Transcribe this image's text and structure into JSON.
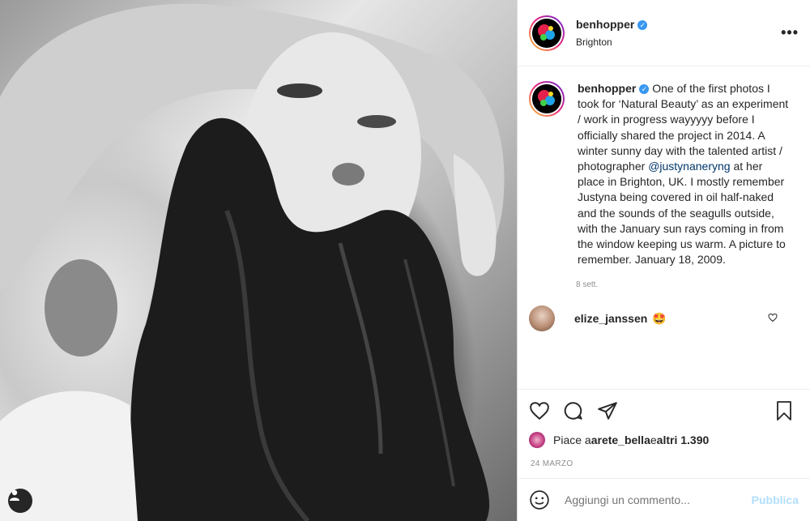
{
  "post": {
    "username": "benhopper",
    "location": "Brighton",
    "more_label": "•••",
    "verified_glyph": "✓",
    "caption_before_mention": "One of the first photos I took for ‘Natural Beauty’ as an experiment / work in progress wayyyyy before I officially shared the project in 2014. A winter sunny day with the talented artist / photographer ",
    "mention": "@justynaneryng",
    "caption_after_mention": " at her place in Brighton, UK. I mostly remember Justyna being covered in oil half-naked and the sounds of the seagulls outside, with the January sun rays coming in from the window keeping us warm. A picture to remember. January 18, 2009.",
    "time_ago": "8 sett.",
    "likes_prefix": "Piace a ",
    "likes_user": "arete_bella",
    "likes_middle": " e ",
    "likes_count": "altri 1.390",
    "date": "24 MARZO"
  },
  "comment": {
    "username": "elize_janssen",
    "emoji": "🤩"
  },
  "compose": {
    "placeholder": "Aggiungi un commento...",
    "publish_label": "Pubblica"
  },
  "icons": [
    "heart-icon",
    "comment-icon",
    "share-icon",
    "bookmark-icon",
    "smiley-icon",
    "user-icon",
    "ellipsis-icon"
  ]
}
